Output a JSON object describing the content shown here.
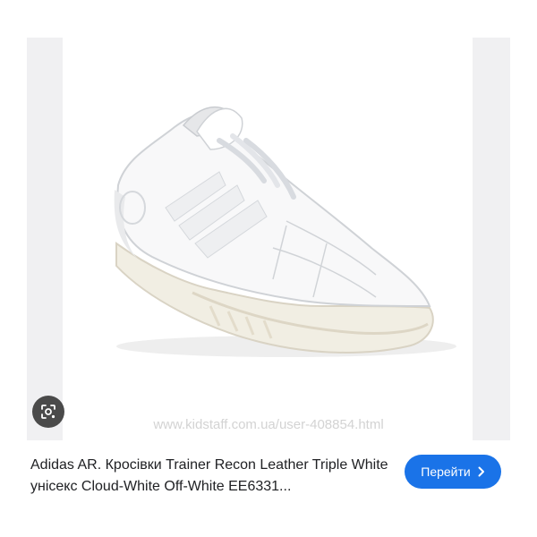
{
  "preview": {
    "watermark": "www.kidstaff.com.ua/user-408854.html"
  },
  "lens": {
    "icon": "lens-icon"
  },
  "result": {
    "title": "Adidas AR. Кросівки Trainer Recon Leather Triple White унісекс Cloud-White Off-White EE6331..."
  },
  "visit": {
    "label": "Перейти",
    "icon": "chevron-right-icon",
    "color": "#1a73e8"
  }
}
